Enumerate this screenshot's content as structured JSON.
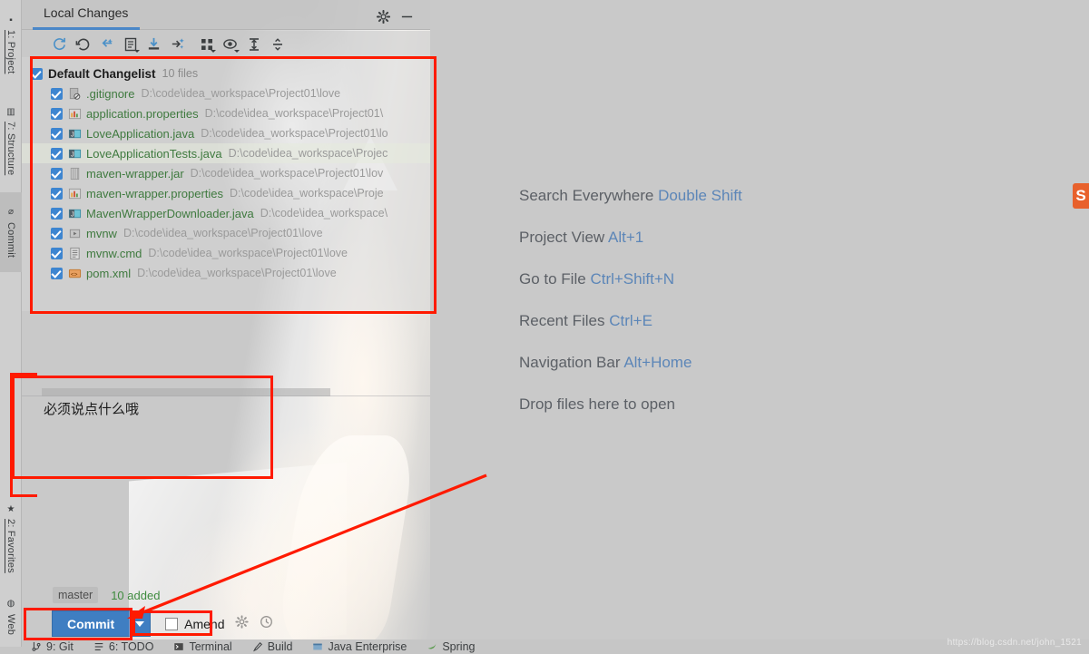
{
  "window": {
    "tool_window_tab": "Local Changes",
    "gear_icon": "gear-icon",
    "minimize_icon": "minimize-icon"
  },
  "left_rail": {
    "items": [
      {
        "label": "1: Project",
        "icon": "folder-icon",
        "selected": false
      },
      {
        "label": "7: Structure",
        "icon": "structure-icon",
        "selected": false
      },
      {
        "label": "Commit",
        "icon": "commit-icon",
        "selected": true
      },
      {
        "label": "2: Favorites",
        "icon": "star-icon",
        "selected": false
      },
      {
        "label": "Web",
        "icon": "web-icon",
        "selected": false
      }
    ]
  },
  "toolbar": {
    "buttons": [
      {
        "name": "refresh-icon",
        "tooltip": "Refresh"
      },
      {
        "name": "rollback-icon",
        "tooltip": "Rollback"
      },
      {
        "name": "shelve-silently-icon",
        "tooltip": "Shelve Silently"
      },
      {
        "name": "show-diff-icon",
        "tooltip": "Show Diff"
      },
      {
        "name": "get-from-vcs-icon",
        "tooltip": "Update"
      },
      {
        "name": "move-to-changelist-icon",
        "tooltip": "Move to Another Changelist"
      },
      {
        "name": "group-by-icon",
        "tooltip": "Group By"
      },
      {
        "name": "preview-diff-icon",
        "tooltip": "Preview Diff"
      },
      {
        "name": "expand-all-icon",
        "tooltip": "Expand All"
      },
      {
        "name": "collapse-all-icon",
        "tooltip": "Collapse All"
      }
    ]
  },
  "changelist": {
    "name": "Default Changelist",
    "count": "10 files",
    "checked": true,
    "files": [
      {
        "name": ".gitignore",
        "path": "D:\\code\\idea_workspace\\Project01\\love",
        "icon": "gitignore-file-icon",
        "checked": true,
        "highlighted": false
      },
      {
        "name": "application.properties",
        "path": "D:\\code\\idea_workspace\\Project01\\",
        "icon": "properties-file-icon",
        "checked": true,
        "highlighted": false
      },
      {
        "name": "LoveApplication.java",
        "path": "D:\\code\\idea_workspace\\Project01\\lo",
        "icon": "java-class-icon",
        "checked": true,
        "highlighted": false
      },
      {
        "name": "LoveApplicationTests.java",
        "path": "D:\\code\\idea_workspace\\Projec",
        "icon": "java-class-icon",
        "checked": true,
        "highlighted": true
      },
      {
        "name": "maven-wrapper.jar",
        "path": "D:\\code\\idea_workspace\\Project01\\lov",
        "icon": "jar-file-icon",
        "checked": true,
        "highlighted": false
      },
      {
        "name": "maven-wrapper.properties",
        "path": "D:\\code\\idea_workspace\\Proje",
        "icon": "properties-file-icon",
        "checked": true,
        "highlighted": false
      },
      {
        "name": "MavenWrapperDownloader.java",
        "path": "D:\\code\\idea_workspace\\",
        "icon": "java-class-icon",
        "checked": true,
        "highlighted": false
      },
      {
        "name": "mvnw",
        "path": "D:\\code\\idea_workspace\\Project01\\love",
        "icon": "script-file-icon",
        "checked": true,
        "highlighted": false
      },
      {
        "name": "mvnw.cmd",
        "path": "D:\\code\\idea_workspace\\Project01\\love",
        "icon": "cmd-file-icon",
        "checked": true,
        "highlighted": false
      },
      {
        "name": "pom.xml",
        "path": "D:\\code\\idea_workspace\\Project01\\love",
        "icon": "xml-file-icon",
        "checked": true,
        "highlighted": false
      }
    ]
  },
  "commit_message": {
    "value": "必须说点什么哦",
    "placeholder": ""
  },
  "commit_controls": {
    "branch": "master",
    "added": "10 added",
    "commit_label": "Commit",
    "commit_mnemonic": "i",
    "dropdown_icon": "chevron-down-icon",
    "amend_label": "Amend",
    "amend_checked": false,
    "settings_icon": "gear-icon",
    "history_icon": "clock-icon"
  },
  "editor_hints": [
    {
      "label": "Search Everywhere",
      "key": "Double Shift"
    },
    {
      "label": "Project View",
      "key": "Alt+1"
    },
    {
      "label": "Go to File",
      "key": "Ctrl+Shift+N"
    },
    {
      "label": "Recent Files",
      "key": "Ctrl+E"
    },
    {
      "label": "Navigation Bar",
      "key": "Alt+Home"
    },
    {
      "label": "Drop files here to open",
      "key": ""
    }
  ],
  "right_edge": {
    "icon": "sonarlint-icon",
    "glyph": "S"
  },
  "status_bar": {
    "items": [
      {
        "label": "9: Git",
        "icon": "git-icon"
      },
      {
        "label": "6: TODO",
        "icon": "todo-icon"
      },
      {
        "label": "Terminal",
        "icon": "terminal-icon"
      },
      {
        "label": "Build",
        "icon": "build-icon"
      },
      {
        "label": "Java Enterprise",
        "icon": "java-enterprise-icon"
      },
      {
        "label": "Spring",
        "icon": "spring-icon"
      }
    ]
  },
  "watermark": "https://blog.csdn.net/john_1521",
  "colors": {
    "accent_blue": "#3f7ec2",
    "annotation_red": "#ff1a00",
    "file_green": "#3f7a3f",
    "hint_key_blue": "#5c86b8",
    "panel_gray": "#c9c9c9"
  }
}
